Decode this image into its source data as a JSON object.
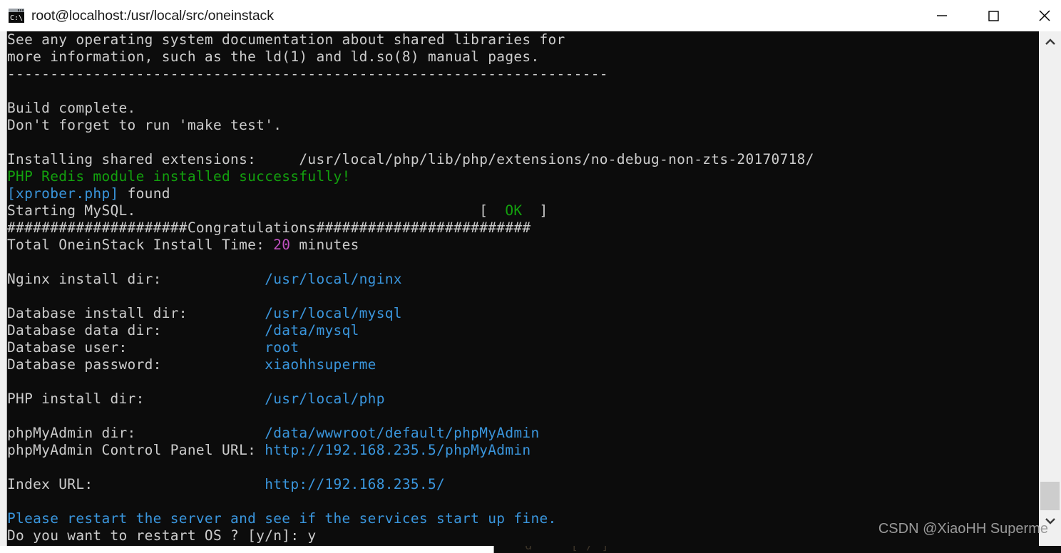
{
  "window": {
    "title": "root@localhost:/usr/local/src/oneinstack",
    "icon": "terminal-icon",
    "controls": {
      "minimize": "minimize-icon",
      "maximize": "maximize-icon",
      "close": "close-icon"
    }
  },
  "scrollbar": {
    "up_arrow": "chevron-up-icon",
    "down_arrow": "chevron-down-icon"
  },
  "watermark": "CSDN @XiaoHH Superme",
  "colors": {
    "background": "#0c0c0c",
    "foreground": "#cccccc",
    "green": "#13a10e",
    "cyan": "#3a96dd",
    "magenta": "#c050c0",
    "titlebar": "#ffffff",
    "scrollbar_track": "#f0f0f0",
    "scrollbar_thumb": "#cdcdcd"
  },
  "terminal": {
    "lines": [
      {
        "id": "l01",
        "segments": [
          {
            "text": "See any operating system documentation about shared libraries for",
            "color": "white"
          }
        ]
      },
      {
        "id": "l02",
        "segments": [
          {
            "text": "more information, such as the ld(1) and ld.so(8) manual pages.",
            "color": "white"
          }
        ]
      },
      {
        "id": "l03",
        "segments": [
          {
            "text": "----------------------------------------------------------------------",
            "color": "white"
          }
        ]
      },
      {
        "id": "l04",
        "segments": [
          {
            "text": "",
            "color": "white"
          }
        ]
      },
      {
        "id": "l05",
        "segments": [
          {
            "text": "Build complete.",
            "color": "white"
          }
        ]
      },
      {
        "id": "l06",
        "segments": [
          {
            "text": "Don't forget to run 'make test'.",
            "color": "white"
          }
        ]
      },
      {
        "id": "l07",
        "segments": [
          {
            "text": "",
            "color": "white"
          }
        ]
      },
      {
        "id": "l08",
        "segments": [
          {
            "text": "Installing shared extensions:     /usr/local/php/lib/php/extensions/no-debug-non-zts-20170718/",
            "color": "white"
          }
        ]
      },
      {
        "id": "l09",
        "segments": [
          {
            "text": "PHP Redis module installed successfully!",
            "color": "green"
          }
        ]
      },
      {
        "id": "l10",
        "segments": [
          {
            "text": "[xprober.php]",
            "color": "cyan"
          },
          {
            "text": " found",
            "color": "white"
          }
        ]
      },
      {
        "id": "l11",
        "segments": [
          {
            "text": "Starting MySQL.                                        [  ",
            "color": "white"
          },
          {
            "text": "OK",
            "color": "green"
          },
          {
            "text": "  ]",
            "color": "white"
          }
        ]
      },
      {
        "id": "l12",
        "segments": [
          {
            "text": "#####################Congratulations#########################",
            "color": "white"
          }
        ]
      },
      {
        "id": "l13",
        "segments": [
          {
            "text": "Total OneinStack Install Time: ",
            "color": "white"
          },
          {
            "text": "20",
            "color": "magenta"
          },
          {
            "text": " minutes",
            "color": "white"
          }
        ]
      },
      {
        "id": "l14",
        "segments": [
          {
            "text": "",
            "color": "white"
          }
        ]
      },
      {
        "id": "l15",
        "segments": [
          {
            "text": "Nginx install dir:            ",
            "color": "white"
          },
          {
            "text": "/usr/local/nginx",
            "color": "cyan"
          }
        ]
      },
      {
        "id": "l16",
        "segments": [
          {
            "text": "",
            "color": "white"
          }
        ]
      },
      {
        "id": "l17",
        "segments": [
          {
            "text": "Database install dir:         ",
            "color": "white"
          },
          {
            "text": "/usr/local/mysql",
            "color": "cyan"
          }
        ]
      },
      {
        "id": "l18",
        "segments": [
          {
            "text": "Database data dir:            ",
            "color": "white"
          },
          {
            "text": "/data/mysql",
            "color": "cyan"
          }
        ]
      },
      {
        "id": "l19",
        "segments": [
          {
            "text": "Database user:                ",
            "color": "white"
          },
          {
            "text": "root",
            "color": "cyan"
          }
        ]
      },
      {
        "id": "l20",
        "segments": [
          {
            "text": "Database password:            ",
            "color": "white"
          },
          {
            "text": "xiaohhsuperme",
            "color": "cyan"
          }
        ]
      },
      {
        "id": "l21",
        "segments": [
          {
            "text": "",
            "color": "white"
          }
        ]
      },
      {
        "id": "l22",
        "segments": [
          {
            "text": "PHP install dir:              ",
            "color": "white"
          },
          {
            "text": "/usr/local/php",
            "color": "cyan"
          }
        ]
      },
      {
        "id": "l23",
        "segments": [
          {
            "text": "",
            "color": "white"
          }
        ]
      },
      {
        "id": "l24",
        "segments": [
          {
            "text": "phpMyAdmin dir:               ",
            "color": "white"
          },
          {
            "text": "/data/wwwroot/default/phpMyAdmin",
            "color": "cyan"
          }
        ]
      },
      {
        "id": "l25",
        "segments": [
          {
            "text": "phpMyAdmin Control Panel URL: ",
            "color": "white"
          },
          {
            "text": "http://192.168.235.5/phpMyAdmin",
            "color": "cyan"
          }
        ]
      },
      {
        "id": "l26",
        "segments": [
          {
            "text": "",
            "color": "white"
          }
        ]
      },
      {
        "id": "l27",
        "segments": [
          {
            "text": "Index URL:                    ",
            "color": "white"
          },
          {
            "text": "http://192.168.235.5/",
            "color": "cyan"
          }
        ]
      },
      {
        "id": "l28",
        "segments": [
          {
            "text": "",
            "color": "white"
          }
        ]
      },
      {
        "id": "l29",
        "segments": [
          {
            "text": "Please restart the server and see if the services start up fine.",
            "color": "cyan"
          }
        ]
      },
      {
        "id": "l30",
        "segments": [
          {
            "text": "Do you want to restart OS ? [y/n]: y",
            "color": "white"
          }
        ]
      }
    ]
  },
  "background_window": {
    "text": "s  s                  d     [ / ]"
  }
}
